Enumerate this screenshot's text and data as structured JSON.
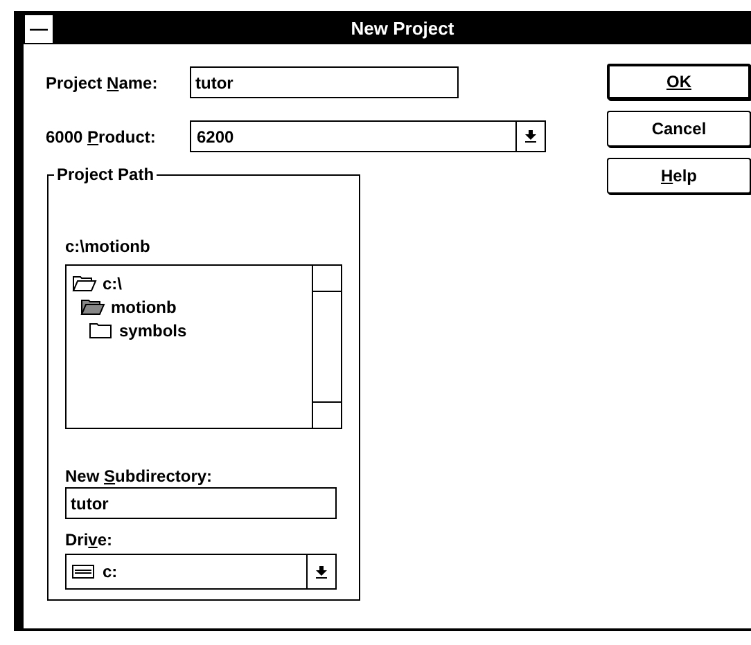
{
  "window": {
    "title": "New Project",
    "system_menu": "—"
  },
  "project_name": {
    "label_parts": [
      {
        "kind": "plain",
        "text": "Project "
      },
      {
        "kind": "access_key",
        "text": "N"
      },
      {
        "kind": "plain",
        "text": "ame:"
      }
    ],
    "value": "tutor"
  },
  "product": {
    "label_parts": [
      {
        "kind": "plain",
        "text": "6000 "
      },
      {
        "kind": "access_key",
        "text": "P"
      },
      {
        "kind": "plain",
        "text": "roduct:"
      }
    ],
    "value": "6200"
  },
  "buttons": [
    {
      "label_parts": [
        {
          "kind": "access_key",
          "text": "OK"
        }
      ],
      "default": true
    },
    {
      "label_parts": [
        {
          "kind": "plain",
          "text": "Cancel"
        }
      ],
      "default": false
    },
    {
      "label_parts": [
        {
          "kind": "access_key",
          "text": "H"
        },
        {
          "kind": "plain",
          "text": "elp"
        }
      ],
      "default": false
    }
  ],
  "project_path": {
    "title": "Project Path",
    "current": "c:\\motionb",
    "tree": [
      {
        "name": "c:\\",
        "open": true,
        "children": [
          {
            "name": "motionb",
            "open": true,
            "children": [
              {
                "name": "symbols",
                "open": false
              }
            ]
          }
        ]
      }
    ],
    "subdirectory": {
      "label_parts": [
        {
          "kind": "plain",
          "text": "New "
        },
        {
          "kind": "access_key",
          "text": "S"
        },
        {
          "kind": "plain",
          "text": "ubdirectory:"
        }
      ],
      "value": "tutor"
    },
    "drive": {
      "label_parts": [
        {
          "kind": "plain",
          "text": "Dri"
        },
        {
          "kind": "access_key",
          "text": "v"
        },
        {
          "kind": "plain",
          "text": "e:"
        }
      ],
      "value": "c:"
    }
  }
}
